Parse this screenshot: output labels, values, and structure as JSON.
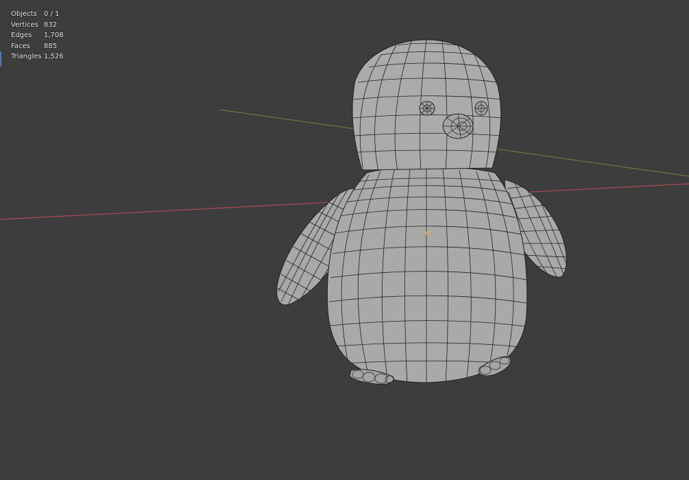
{
  "viewport": {
    "background": "#3d3d3d",
    "axis_x_color": "#b04a55",
    "axis_y_color": "#6d8a3c",
    "mesh_fill": "#a7a7a7",
    "wire_color": "#1e1e1e",
    "origin_color": "#f2a93b"
  },
  "stats": {
    "objects": {
      "label": "Objects",
      "value": "0 / 1"
    },
    "vertices": {
      "label": "Vertices",
      "value": "832"
    },
    "edges": {
      "label": "Edges",
      "value": "1,708"
    },
    "faces": {
      "label": "Faces",
      "value": "885"
    },
    "triangles": {
      "label": "Triangles",
      "value": "1,526"
    }
  }
}
